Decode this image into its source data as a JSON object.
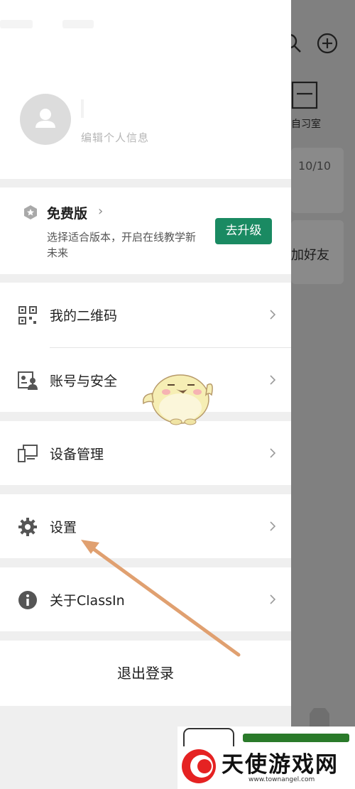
{
  "background": {
    "progress": "10/10",
    "add_friend": "加好友",
    "study_room": "自习室"
  },
  "profile": {
    "edit_info": "编辑个人信息"
  },
  "plan": {
    "title": "免费版",
    "chevron": "›",
    "description": "选择适合版本，开启在线教学新未来",
    "upgrade_label": "去升级"
  },
  "menu": {
    "qr_code": "我的二维码",
    "account_security": "账号与安全",
    "device_management": "设备管理",
    "settings": "设置",
    "about": "关于ClassIn",
    "logout": "退出登录"
  },
  "brand": {
    "name": "天使游戏网",
    "url": "www.townangel.com"
  },
  "colors": {
    "accent_green": "#1a8a62",
    "annotation_arrow": "#e0a070"
  }
}
